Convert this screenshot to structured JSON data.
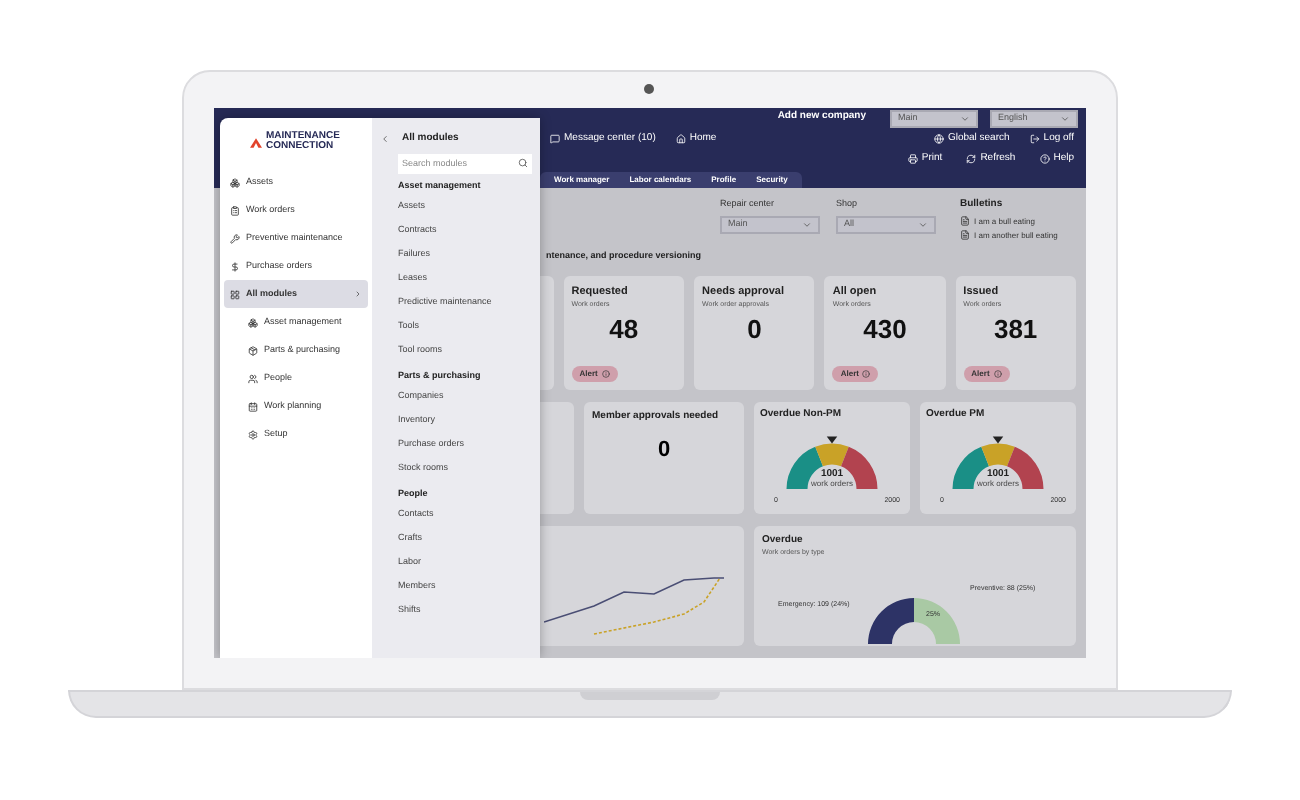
{
  "header": {
    "company_action": "Add new company",
    "company_select": "Main",
    "language_select": "English",
    "nav": [
      {
        "label": "Message center (10)",
        "kind": "message"
      },
      {
        "label": "Home",
        "kind": "home"
      }
    ],
    "actions": [
      {
        "label": "Global search",
        "kind": "globe"
      },
      {
        "label": "Log off",
        "kind": "logoff"
      }
    ],
    "tools": [
      {
        "label": "Print",
        "kind": "print"
      },
      {
        "label": "Refresh",
        "kind": "refresh"
      },
      {
        "label": "Help",
        "kind": "help"
      }
    ],
    "tabs": [
      {
        "label": "Work manager",
        "selected": false
      },
      {
        "label": "Labor calendars",
        "selected": false
      },
      {
        "label": "Profile",
        "selected": false
      },
      {
        "label": "Security",
        "selected": false
      }
    ]
  },
  "filters": [
    {
      "label": "Repair center",
      "value": "Main"
    },
    {
      "label": "Shop",
      "value": "All"
    }
  ],
  "bulletins": {
    "title": "Bulletins",
    "items": [
      "I am a bull eating",
      "I am another bull eating"
    ]
  },
  "section_title": "ntenance, and procedure versioning",
  "cards": [
    {
      "title": "Requested",
      "subtitle": "Work orders",
      "value": "48",
      "alert": "Alert"
    },
    {
      "title": "Needs approval",
      "subtitle": "Work order approvals",
      "value": "0"
    },
    {
      "title": "All open",
      "subtitle": "Work orders",
      "value": "430",
      "alert": "Alert"
    },
    {
      "title": "Issued",
      "subtitle": "Work orders",
      "value": "381",
      "alert": "Alert"
    }
  ],
  "member_card": {
    "title": "Member approvals needed",
    "value": "0"
  },
  "gauges": [
    {
      "title": "Overdue Non-PM",
      "value": "1001",
      "unit": "work orders",
      "min": "0",
      "max": "2000",
      "level": 0.5
    },
    {
      "title": "Overdue PM",
      "value": "1001",
      "unit": "work orders",
      "min": "0",
      "max": "2000",
      "level": 0.5
    }
  ],
  "overdue": {
    "title": "Overdue",
    "subtitle": "Work orders by type",
    "labels": [
      "Emergency: 109 (24%)",
      "Preventive: 88 (25%)"
    ],
    "slice_label": "25%"
  },
  "sidebar": {
    "logo": [
      "MAINTENANCE",
      "CONNECTION"
    ],
    "items": [
      {
        "label": "Assets",
        "kind": "assets",
        "selected": false
      },
      {
        "label": "Work orders",
        "kind": "orders",
        "selected": false
      },
      {
        "label": "Preventive maintenance",
        "kind": "wrench",
        "selected": false
      },
      {
        "label": "Purchase orders",
        "kind": "dollar",
        "selected": false
      },
      {
        "label": "All modules",
        "kind": "grid",
        "selected": true,
        "expanded": true
      }
    ],
    "subitems": [
      {
        "label": "Asset management",
        "kind": "assets"
      },
      {
        "label": "Parts & purchasing",
        "kind": "parts"
      },
      {
        "label": "People",
        "kind": "people"
      },
      {
        "label": "Work planning",
        "kind": "calendar"
      },
      {
        "label": "Setup",
        "kind": "gear"
      }
    ]
  },
  "modules": {
    "title": "All modules",
    "search_placeholder": "Search modules",
    "groups": [
      {
        "name": "Asset management",
        "items": [
          "Assets",
          "Contracts",
          "Failures",
          "Leases",
          "Predictive maintenance",
          "Tools",
          "Tool rooms"
        ]
      },
      {
        "name": "Parts & purchasing",
        "items": [
          "Companies",
          "Inventory",
          "Purchase orders",
          "Stock rooms"
        ]
      },
      {
        "name": "People",
        "items": [
          "Contacts",
          "Crafts",
          "Labor",
          "Members",
          "Shifts"
        ]
      }
    ]
  }
}
